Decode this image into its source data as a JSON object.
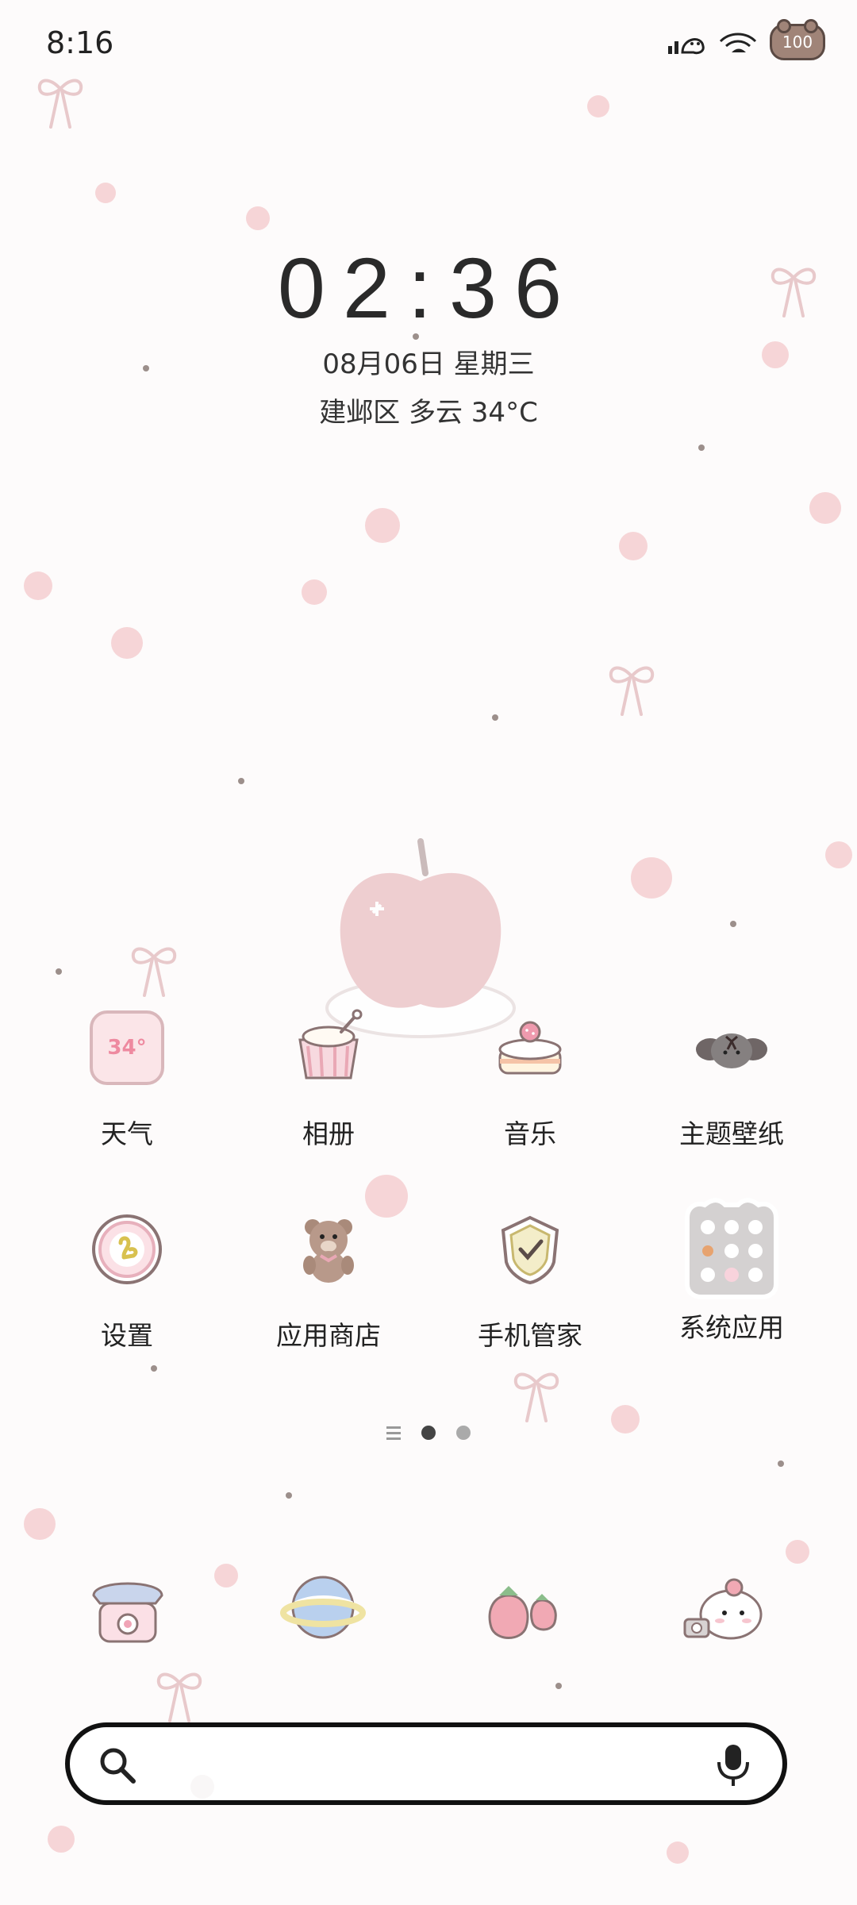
{
  "status_bar": {
    "time": "8:16",
    "battery_level": "100"
  },
  "clock_widget": {
    "time": "02:36",
    "date": "08月06日 星期三",
    "weather": "建邺区 多云 34°C"
  },
  "apps": [
    {
      "label": "天气",
      "icon": "weather-icon",
      "icon_text": "34°"
    },
    {
      "label": "相册",
      "icon": "gallery-icon"
    },
    {
      "label": "音乐",
      "icon": "music-icon"
    },
    {
      "label": "主题壁纸",
      "icon": "themes-icon"
    },
    {
      "label": "设置",
      "icon": "settings-icon"
    },
    {
      "label": "应用商店",
      "icon": "app-store-icon"
    },
    {
      "label": "手机管家",
      "icon": "phone-manager-icon"
    },
    {
      "label": "系统应用",
      "icon": "system-apps-folder-icon"
    }
  ],
  "dock": [
    "phone-icon",
    "browser-icon",
    "messages-icon",
    "camera-icon"
  ],
  "page_indicator": {
    "pages": 2,
    "current": 1
  },
  "search_bar": {
    "placeholder": ""
  },
  "colors": {
    "wallpaper": "#fdfbfb",
    "accent_pink": "#f3c9cc",
    "search_border": "#111111"
  }
}
